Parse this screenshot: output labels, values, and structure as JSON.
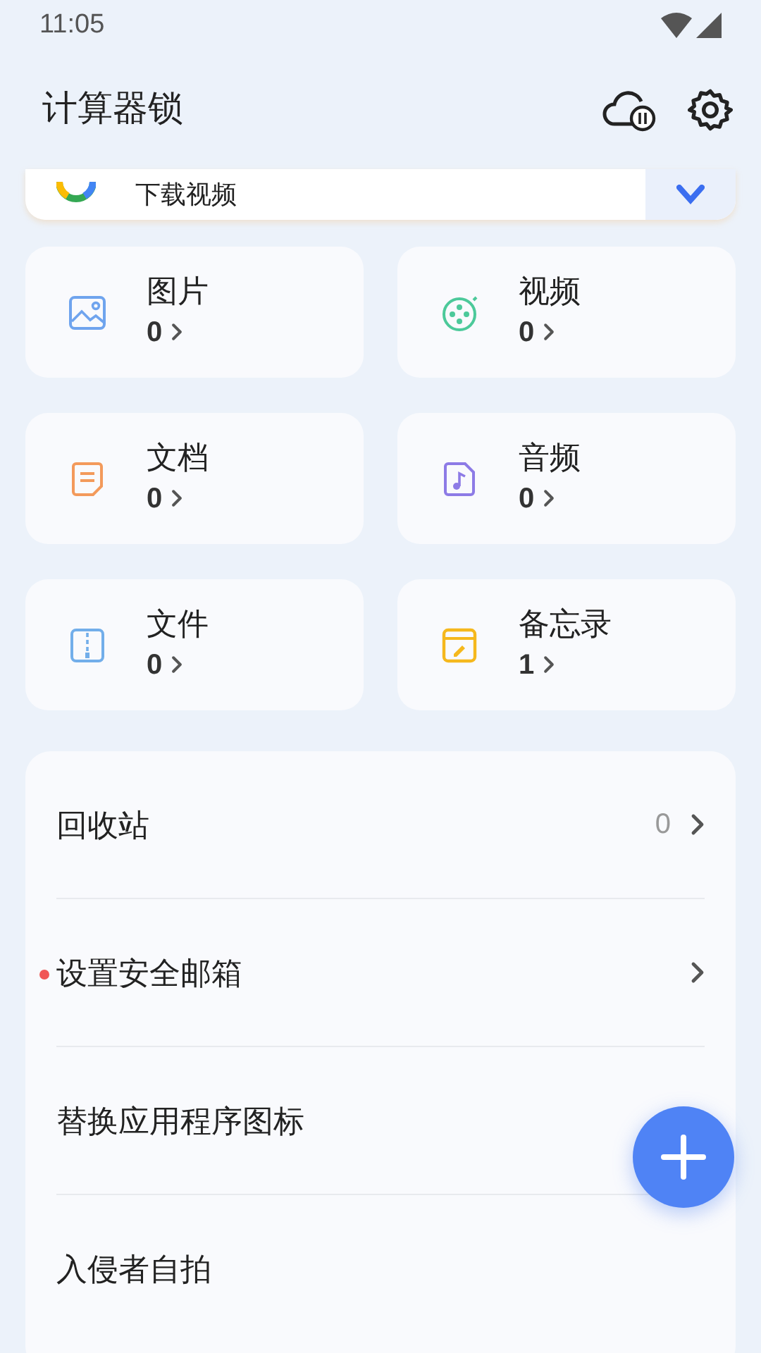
{
  "status_bar": {
    "time": "11:05"
  },
  "header": {
    "title": "计算器锁"
  },
  "banner": {
    "label": "下载视频"
  },
  "categories": [
    {
      "kind": "image",
      "label": "图片",
      "count": "0"
    },
    {
      "kind": "video",
      "label": "视频",
      "count": "0"
    },
    {
      "kind": "document",
      "label": "文档",
      "count": "0"
    },
    {
      "kind": "audio",
      "label": "音频",
      "count": "0"
    },
    {
      "kind": "archive",
      "label": "文件",
      "count": "0"
    },
    {
      "kind": "note",
      "label": "备忘录",
      "count": "1"
    }
  ],
  "menu": [
    {
      "label": "回收站",
      "count": "0",
      "dot": false,
      "chevron": true
    },
    {
      "label": "设置安全邮箱",
      "dot": true,
      "chevron": true
    },
    {
      "label": "替换应用程序图标",
      "dot": false,
      "chevron": false
    },
    {
      "label": "入侵者自拍",
      "dot": false,
      "chevron": false
    }
  ]
}
